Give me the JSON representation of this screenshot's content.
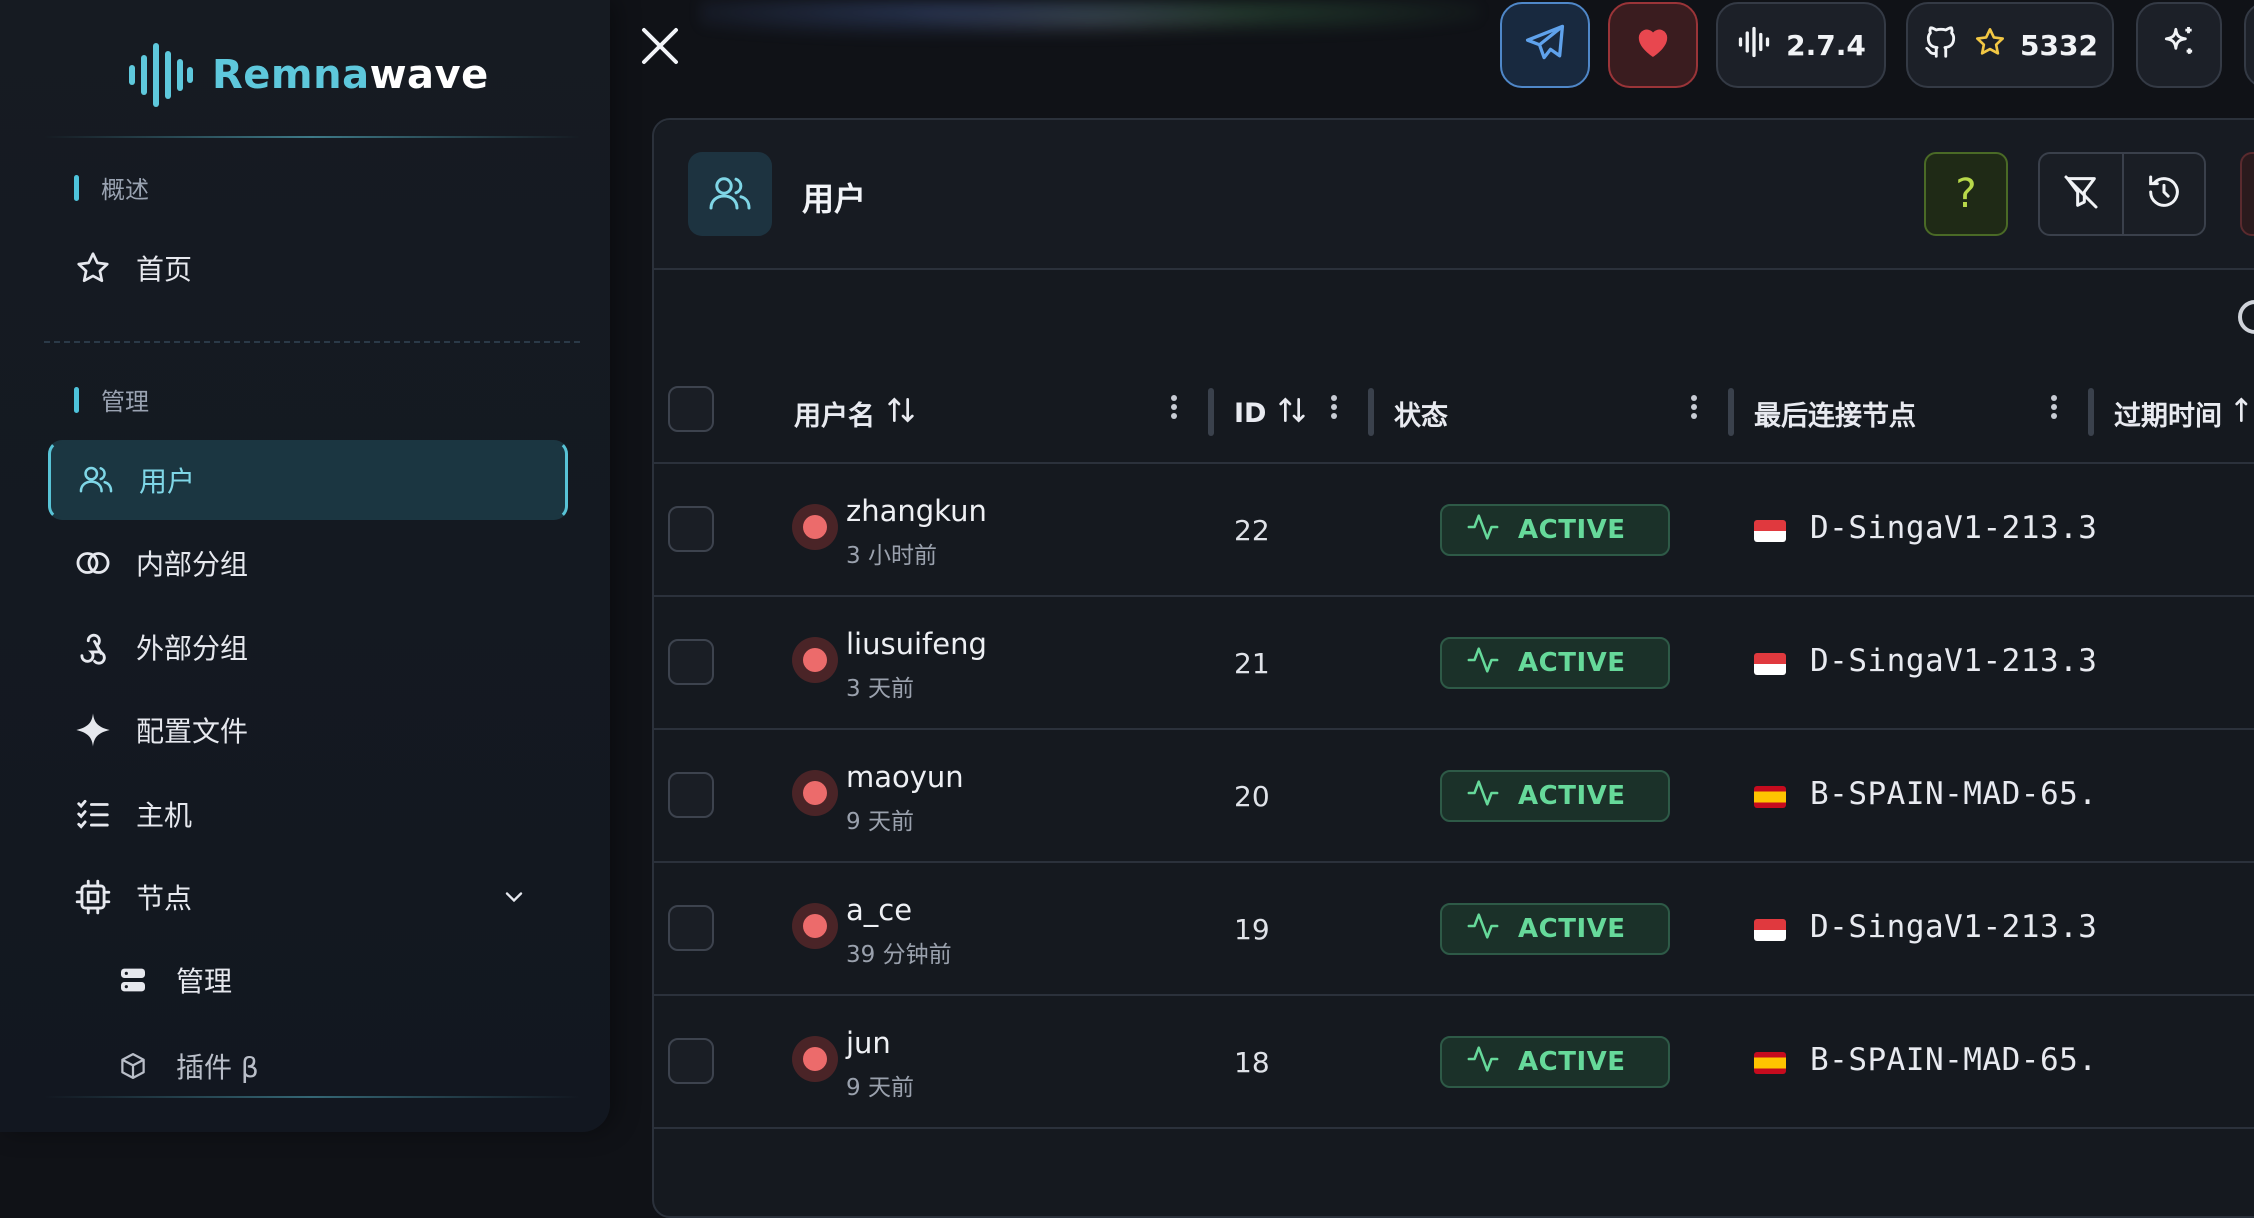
{
  "brand": {
    "name_part1": "Remna",
    "name_part2": "wave",
    "accent": "#5ec8dc"
  },
  "sidebar": {
    "section_overview": "概述",
    "section_manage": "管理",
    "items": [
      {
        "label": "首页",
        "icon": "star-icon"
      },
      {
        "label": "用户",
        "icon": "users-icon",
        "active": true
      },
      {
        "label": "内部分组",
        "icon": "link-circles-icon"
      },
      {
        "label": "外部分组",
        "icon": "webhook-icon"
      },
      {
        "label": "配置文件",
        "icon": "sparkle-icon"
      },
      {
        "label": "主机",
        "icon": "checklist-icon"
      },
      {
        "label": "节点",
        "icon": "cpu-icon",
        "expanded": true
      },
      {
        "label": "管理",
        "icon": "server-icon",
        "sub": true
      },
      {
        "label": "插件 β",
        "icon": "package-icon",
        "sub": true
      }
    ]
  },
  "topbar": {
    "version": "2.7.4",
    "github_stars": "5332"
  },
  "page": {
    "title": "用户",
    "help": "?"
  },
  "table": {
    "columns": {
      "username": "用户名",
      "id": "ID",
      "status": "状态",
      "last_node": "最后连接节点",
      "expires": "过期时间"
    },
    "rows": [
      {
        "username": "zhangkun",
        "seen": "3 小时前",
        "id": "22",
        "status": "ACTIVE",
        "flag": "sg",
        "node": "D-SingaV1-213.3"
      },
      {
        "username": "liusuifeng",
        "seen": "3 天前",
        "id": "21",
        "status": "ACTIVE",
        "flag": "sg",
        "node": "D-SingaV1-213.3"
      },
      {
        "username": "maoyun",
        "seen": "9 天前",
        "id": "20",
        "status": "ACTIVE",
        "flag": "es",
        "node": "B-SPAIN-MAD-65."
      },
      {
        "username": "a_ce",
        "seen": "39 分钟前",
        "id": "19",
        "status": "ACTIVE",
        "flag": "sg",
        "node": "D-SingaV1-213.3"
      },
      {
        "username": "jun",
        "seen": "9 天前",
        "id": "18",
        "status": "ACTIVE",
        "flag": "es",
        "node": "B-SPAIN-MAD-65."
      }
    ]
  }
}
